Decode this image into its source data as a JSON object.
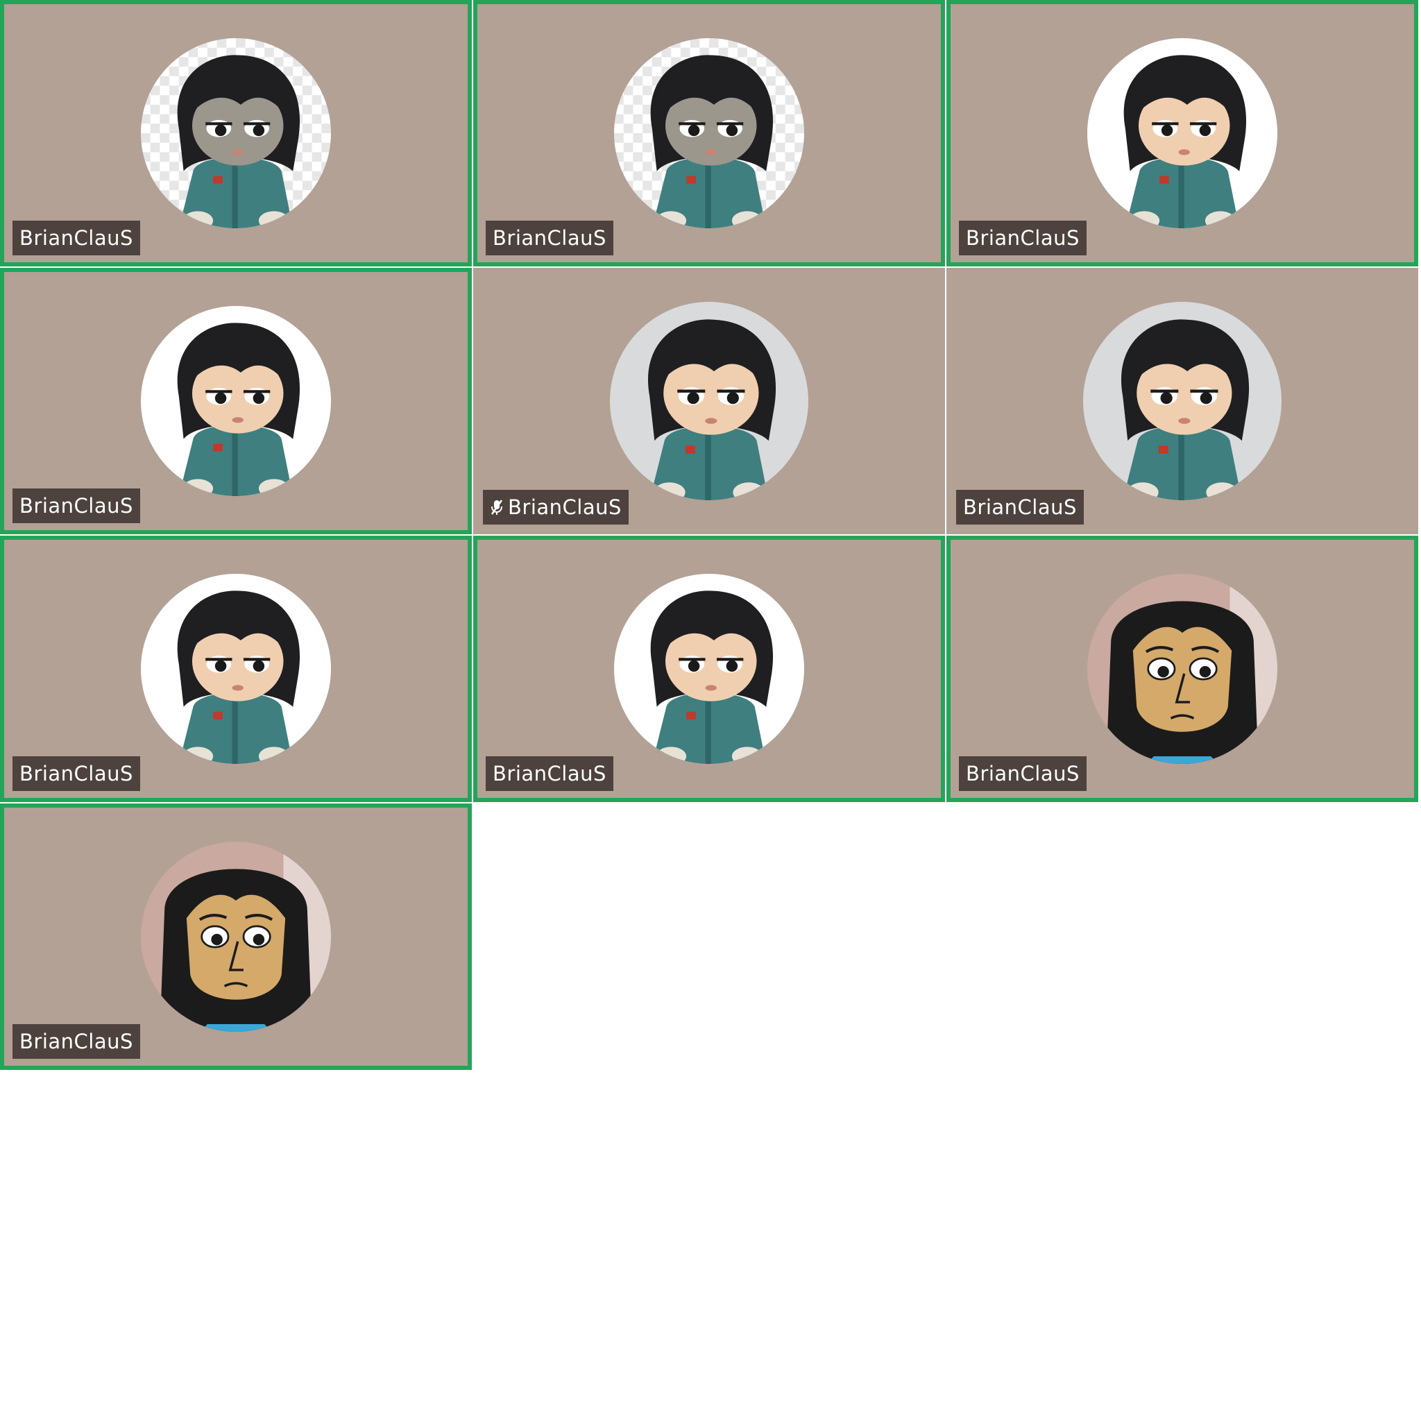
{
  "colors": {
    "tile_background": "#b3a195",
    "speaking_border": "#23a559",
    "nameplate_background": "#4d423d",
    "nameplate_text": "#ffffff"
  },
  "participants": [
    {
      "name": "BrianClauS",
      "speaking": true,
      "muted": false,
      "avatar": "plush-doll-blurry-avatar"
    },
    {
      "name": "BrianClauS",
      "speaking": true,
      "muted": false,
      "avatar": "plush-doll-blurry-avatar"
    },
    {
      "name": "BrianClauS",
      "speaking": true,
      "muted": false,
      "avatar": "plush-doll-white-bg-avatar"
    },
    {
      "name": "BrianClauS",
      "speaking": true,
      "muted": false,
      "avatar": "plush-doll-white-bg-avatar"
    },
    {
      "name": "BrianClauS",
      "speaking": false,
      "muted": true,
      "avatar": "plush-doll-photo-avatar",
      "mute_icon": "microphone-muted-icon"
    },
    {
      "name": "BrianClauS",
      "speaking": false,
      "muted": false,
      "avatar": "plush-doll-photo-avatar"
    },
    {
      "name": "BrianClauS",
      "speaking": true,
      "muted": false,
      "avatar": "plush-doll-white-bg-avatar"
    },
    {
      "name": "BrianClauS",
      "speaking": true,
      "muted": false,
      "avatar": "plush-doll-white-bg-avatar"
    },
    {
      "name": "BrianClauS",
      "speaking": true,
      "muted": false,
      "avatar": "mii-character-avatar"
    },
    {
      "name": "BrianClauS",
      "speaking": true,
      "muted": false,
      "avatar": "mii-character-avatar"
    }
  ]
}
